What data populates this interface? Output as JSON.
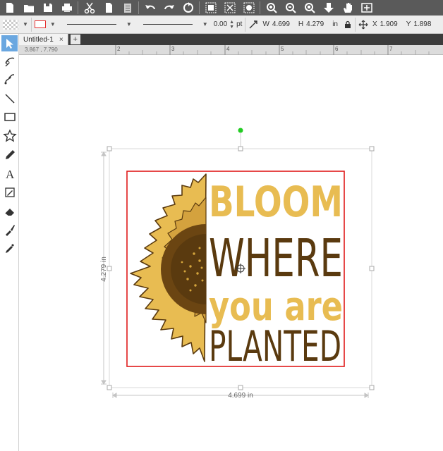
{
  "toolbar": {
    "icons": [
      "new-document-icon",
      "open-folder-icon",
      "save-icon",
      "print-icon",
      "cut-icon",
      "copy-icon",
      "paste-icon",
      "undo-icon",
      "redo-icon",
      "refresh-icon",
      "group-icon",
      "ungroup-icon",
      "media-icon",
      "zoom-in-icon",
      "zoom-out-icon",
      "zoom-fit-icon",
      "move-down-icon",
      "pan-hand-icon",
      "zoom-select-icon"
    ]
  },
  "props": {
    "stroke_width": "0.00",
    "stroke_unit": "pt",
    "w_label": "W",
    "w_value": "4.699",
    "h_label": "H",
    "h_value": "4.279",
    "size_unit": "in",
    "x_label": "X",
    "x_value": "1.909",
    "y_label": "Y",
    "y_value": "1.898",
    "line_color": "#e53030"
  },
  "tabs": [
    {
      "label": "Untitled-1",
      "close": "×"
    }
  ],
  "tab_add": "+",
  "ruler": {
    "coords": "3.867 , 7.790",
    "ticks": [
      "2",
      "3",
      "4",
      "5",
      "6",
      "7"
    ]
  },
  "design": {
    "line1": "BLOOM",
    "line2": "WHERE",
    "line3": "you are",
    "line4": "PLANTED",
    "colors": {
      "gold": "#e8bc52",
      "brown": "#5a3a0f",
      "selection": "#e01b1b"
    }
  },
  "dimensions": {
    "width": "4.699 in",
    "height": "4.279 in"
  }
}
